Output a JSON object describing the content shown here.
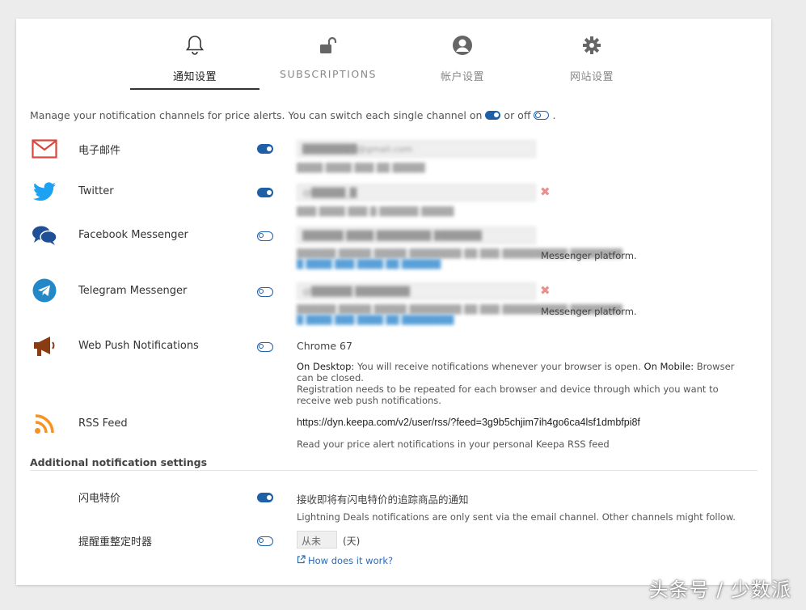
{
  "tabs": [
    {
      "label": "通知设置",
      "icon": "bell-icon"
    },
    {
      "label": "SUBSCRIPTIONS",
      "icon": "unlock-icon"
    },
    {
      "label": "帐户设置",
      "icon": "user-circle-icon"
    },
    {
      "label": "网站设置",
      "icon": "gear-icon"
    }
  ],
  "intro": {
    "text": "Manage your notification channels for price alerts. You can switch each single channel on",
    "or_off": "or off",
    "period": "."
  },
  "channels": {
    "email": {
      "label": "电子邮件",
      "enabled": true,
      "icon": "mail-icon"
    },
    "twitter": {
      "label": "Twitter",
      "enabled": true,
      "icon": "twitter-icon"
    },
    "facebook": {
      "label": "Facebook Messenger",
      "enabled": false,
      "icon": "chat-bubbles-icon",
      "note_tail": "Messenger platform."
    },
    "telegram": {
      "label": "Telegram Messenger",
      "enabled": false,
      "icon": "telegram-icon",
      "note_tail": "Messenger platform."
    },
    "webpush": {
      "label": "Web Push Notifications",
      "enabled": false,
      "icon": "megaphone-icon",
      "browser": "Chrome 67",
      "desktop_label": "On Desktop:",
      "desktop_text": "You will receive notifications whenever your browser is open.",
      "mobile_label": "On Mobile:",
      "mobile_text": "Browser can be closed.",
      "registration_text": "Registration needs to be repeated for each browser and device through which you want to receive web push notifications."
    },
    "rss": {
      "label": "RSS Feed",
      "icon": "rss-icon",
      "url": "https://dyn.keepa.com/v2/user/rss/?feed=3g9b5chjim7ih4go6ca4lsf1dmbfpi8f",
      "note": "Read your price alert notifications in your personal Keepa RSS feed"
    }
  },
  "additional": {
    "title": "Additional notification settings",
    "lightning": {
      "label": "闪电特价",
      "enabled": true,
      "text": "接收即将有闪电特价的追踪商品的通知",
      "note": "Lightning Deals notifications are only sent via the email channel. Other channels might follow."
    },
    "reminder": {
      "label": "提醒重整定时器",
      "enabled": false,
      "value": "从未",
      "unit": "(天)",
      "link": "How does it work?"
    }
  },
  "watermark": "头条号 / 少数派",
  "colors": {
    "accent": "#1f5fa6",
    "email_red": "#d9473c",
    "twitter_blue": "#1da1f2",
    "rss_orange": "#f7931e",
    "megaphone_brown": "#8a3b12"
  }
}
